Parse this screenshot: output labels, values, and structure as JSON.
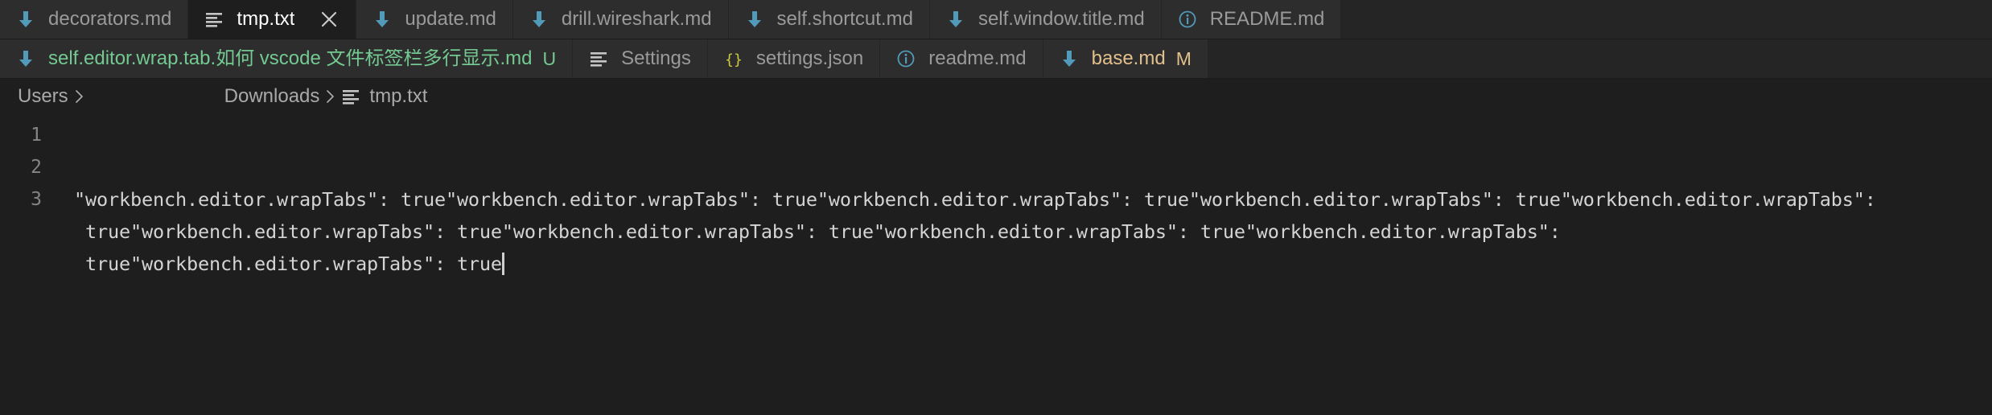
{
  "window": {
    "app": "Visual Studio Code",
    "theme": "dark"
  },
  "colors": {
    "tab_bar_bg": "#252526",
    "tab_inactive_bg": "#2d2d2d",
    "tab_active_bg": "#1e1e1e",
    "editor_bg": "#1e1e1e",
    "text_inactive": "#9a9a9a",
    "text_active": "#ffffff",
    "git_untracked_green": "#73c991",
    "git_modified_orange": "#e2c08d",
    "icon_markdown_blue": "#519aba",
    "icon_json_yellow": "#cbcb41",
    "icon_info_blue": "#519aba",
    "line_number": "#858585",
    "code_text": "#d4d4d4",
    "breadcrumb_text": "#a9a9a9"
  },
  "tabs": {
    "rows": [
      {
        "row_index": 1,
        "items": [
          {
            "label": "decorators.md",
            "icon": "markdown-down-arrow-icon",
            "icon_kind": "md",
            "active": false,
            "badge": "",
            "status": "none",
            "closeable": false
          },
          {
            "label": "tmp.txt",
            "icon": "text-file-icon",
            "icon_kind": "txt",
            "active": true,
            "badge": "",
            "status": "none",
            "closeable": true
          },
          {
            "label": "update.md",
            "icon": "markdown-down-arrow-icon",
            "icon_kind": "md",
            "active": false,
            "badge": "",
            "status": "none",
            "closeable": false
          },
          {
            "label": "drill.wireshark.md",
            "icon": "markdown-down-arrow-icon",
            "icon_kind": "md",
            "active": false,
            "badge": "",
            "status": "none",
            "closeable": false
          },
          {
            "label": "self.shortcut.md",
            "icon": "markdown-down-arrow-icon",
            "icon_kind": "md",
            "active": false,
            "badge": "",
            "status": "none",
            "closeable": false
          },
          {
            "label": "self.window.title.md",
            "icon": "markdown-down-arrow-icon",
            "icon_kind": "md",
            "active": false,
            "badge": "",
            "status": "none",
            "closeable": false
          },
          {
            "label": "README.md",
            "icon": "info-circle-icon",
            "icon_kind": "info",
            "active": false,
            "badge": "",
            "status": "none",
            "closeable": false
          }
        ]
      },
      {
        "row_index": 2,
        "items": [
          {
            "label": "self.editor.wrap.tab.如何 vscode 文件标签栏多行显示.md",
            "icon": "markdown-down-arrow-icon",
            "icon_kind": "md",
            "active": false,
            "badge": "U",
            "status": "untracked",
            "closeable": false
          },
          {
            "label": "Settings",
            "icon": "text-file-icon",
            "icon_kind": "txt",
            "active": false,
            "badge": "",
            "status": "none",
            "closeable": false
          },
          {
            "label": "settings.json",
            "icon": "json-braces-icon",
            "icon_kind": "json",
            "active": false,
            "badge": "",
            "status": "none",
            "closeable": false
          },
          {
            "label": "readme.md",
            "icon": "info-circle-icon",
            "icon_kind": "info",
            "active": false,
            "badge": "",
            "status": "none",
            "closeable": false
          },
          {
            "label": "base.md",
            "icon": "markdown-down-arrow-icon",
            "icon_kind": "md",
            "active": false,
            "badge": "M",
            "status": "modified",
            "closeable": false
          }
        ]
      }
    ],
    "close_tooltip": "Close"
  },
  "breadcrumbs": {
    "items": [
      {
        "label": "Users",
        "icon": "",
        "gap_after": true
      },
      {
        "label": "Downloads",
        "icon": "",
        "gap_after": false
      },
      {
        "label": "tmp.txt",
        "icon": "text-file-icon",
        "gap_after": false
      }
    ],
    "separator": "›"
  },
  "editor": {
    "file": "tmp.txt",
    "line_numbers": [
      "1",
      "2",
      "3"
    ],
    "lines": [
      {
        "number": "1",
        "text": ""
      },
      {
        "number": "2",
        "text": ""
      },
      {
        "number": "3",
        "wrapped_segments": [
          "\"workbench.editor.wrapTabs\": true\"workbench.editor.wrapTabs\": true\"workbench.editor.wrapTabs\": true\"workbench.editor.wrapTabs\": true\"workbench.editor.wrapTabs\":",
          " true\"workbench.editor.wrapTabs\": true\"workbench.editor.wrapTabs\": true\"workbench.editor.wrapTabs\": true\"workbench.editor.wrapTabs\":",
          " true\"workbench.editor.wrapTabs\": true"
        ],
        "cursor_at_end": true
      }
    ]
  }
}
